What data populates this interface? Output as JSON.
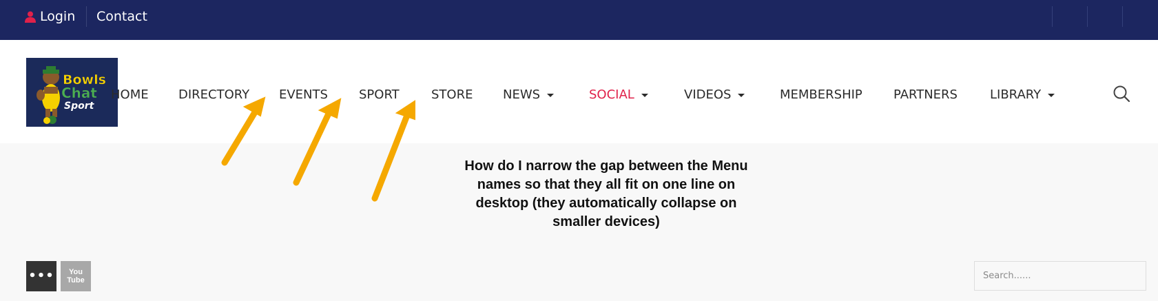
{
  "topbar": {
    "login_label": "Login",
    "contact_label": "Contact",
    "background": "#1c2660"
  },
  "logo": {
    "line1": "Bowls",
    "line2": "Chat",
    "line3": "Sport"
  },
  "nav": {
    "items": [
      {
        "label": "HOME",
        "dropdown": false
      },
      {
        "label": "DIRECTORY",
        "dropdown": false
      },
      {
        "label": "EVENTS",
        "dropdown": false
      },
      {
        "label": "SPORT",
        "dropdown": false
      },
      {
        "label": "STORE",
        "dropdown": false
      },
      {
        "label": "NEWS",
        "dropdown": true
      },
      {
        "label": "SOCIAL",
        "dropdown": true,
        "active": true
      },
      {
        "label": "VIDEOS",
        "dropdown": true
      },
      {
        "label": "MEMBERSHIP",
        "dropdown": false
      },
      {
        "label": "PARTNERS",
        "dropdown": false
      },
      {
        "label": "LIBRARY",
        "dropdown": true
      }
    ],
    "active_color": "#e0214a",
    "search_icon": "search-icon"
  },
  "annotation": {
    "text": "How do I narrow the gap between the Menu names so that they all fit on one line on desktop (they automatically collapse on smaller devices)",
    "arrow_color": "#f5a800"
  },
  "footer": {
    "share_icon": "more-icon",
    "youtube_text_1": "You",
    "youtube_text_2": "Tube",
    "search_placeholder": "Search......"
  }
}
